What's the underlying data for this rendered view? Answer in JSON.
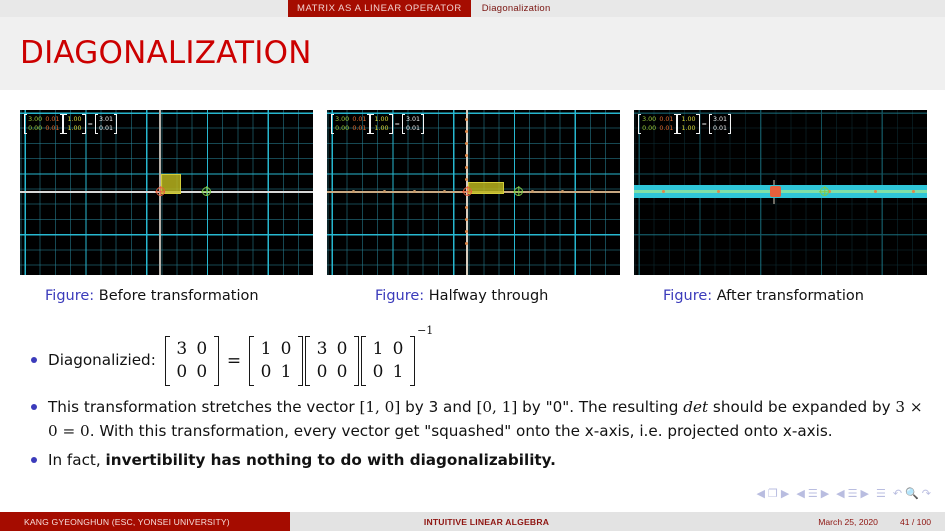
{
  "header": {
    "active_section": "MATRIX AS A LINEAR OPERATOR",
    "current_subsection": "Diagonalization"
  },
  "title": "DIAGONALIZATION",
  "figures": [
    {
      "caption_label": "Figure:",
      "caption_text": "Before transformation",
      "annotation": {
        "matrix_a": [
          [
            "3.00",
            "0.01"
          ],
          [
            "0.00",
            "0.01"
          ]
        ],
        "vector_x": [
          "1.00",
          "1.00"
        ],
        "equals": "=",
        "result": [
          "3.01",
          "0.01"
        ]
      }
    },
    {
      "caption_label": "Figure:",
      "caption_text": "Halfway through",
      "annotation": {
        "matrix_a": [
          [
            "3.00",
            "0.01"
          ],
          [
            "0.00",
            "0.01"
          ]
        ],
        "vector_x": [
          "1.00",
          "1.00"
        ],
        "equals": "=",
        "result": [
          "3.01",
          "0.01"
        ]
      }
    },
    {
      "caption_label": "Figure:",
      "caption_text": "After transformation",
      "annotation": {
        "matrix_a": [
          [
            "3.00",
            "0.01"
          ],
          [
            "0.00",
            "0.01"
          ]
        ],
        "vector_x": [
          "1.00",
          "1.00"
        ],
        "equals": "=",
        "result": [
          "3.01",
          "0.01"
        ]
      }
    }
  ],
  "bullets": {
    "b1": {
      "label": "Diagonalizied:",
      "lhs": [
        [
          "3",
          "0"
        ],
        [
          "0",
          "0"
        ]
      ],
      "eq": "=",
      "m1": [
        [
          "1",
          "0"
        ],
        [
          "0",
          "1"
        ]
      ],
      "m2": [
        [
          "3",
          "0"
        ],
        [
          "0",
          "0"
        ]
      ],
      "m3": [
        [
          "1",
          "0"
        ],
        [
          "0",
          "1"
        ]
      ],
      "exponent": "−1"
    },
    "b2": {
      "part1": "This transformation stretches the vector ",
      "vec1": "[1, 0]",
      "part2": " by 3 and ",
      "vec2": "[0, 1]",
      "part3": " by \"0\". The resulting ",
      "det": "det",
      "part4": " should be expanded by ",
      "calc": "3 × 0 = 0",
      "part5": ". With this transformation, every vector get \"squashed\" onto the x-axis, i.e. projected onto x-axis."
    },
    "b3": {
      "prefix": "In fact, ",
      "bold": "invertibility has nothing to do with diagonalizability."
    }
  },
  "footer": {
    "author": "KANG GYEONGHUN  (ESC, YONSEI UNIVERSITY)",
    "talk_title": "INTUITIVE LINEAR ALGEBRA",
    "date": "March 25, 2020",
    "page": "41 / 100"
  },
  "colors": {
    "brand_red": "#a50c00",
    "title_red": "#cc0000",
    "bullet_blue": "#3b3bbb",
    "grid_cyan": "#28bed7",
    "square_olive": "#bebb1e"
  }
}
